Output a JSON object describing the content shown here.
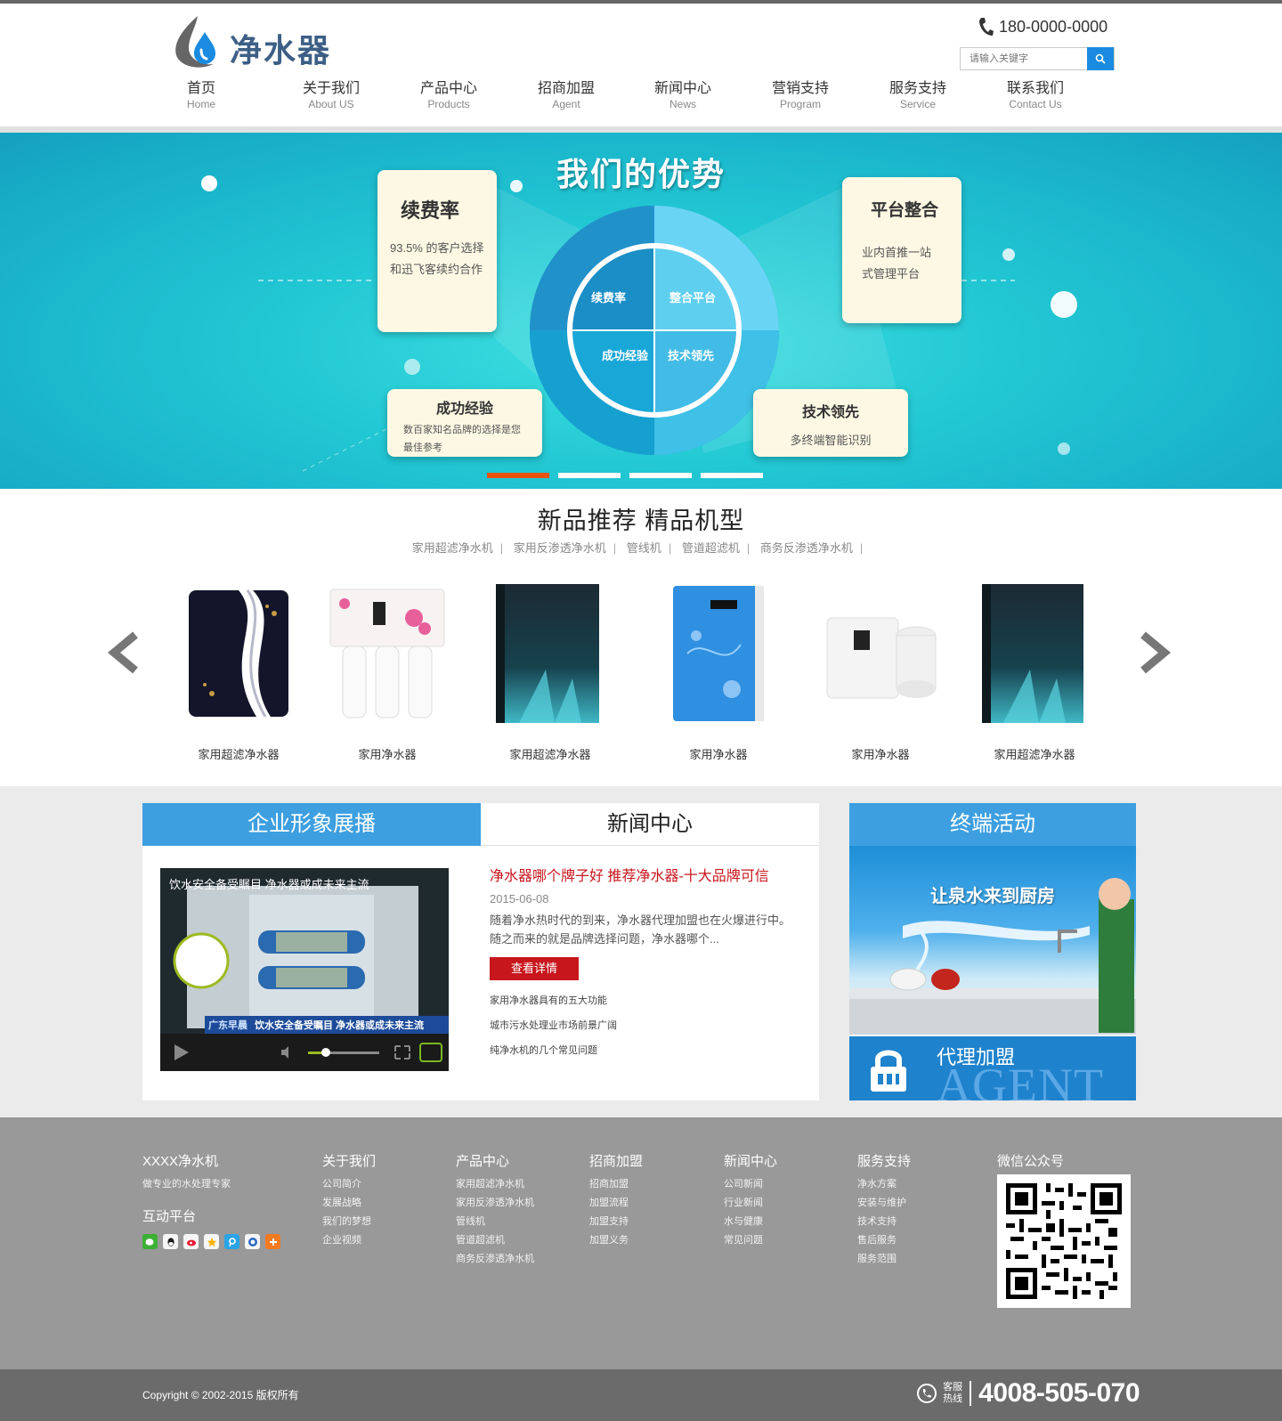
{
  "header": {
    "logo_text": "净水器",
    "phone": "180-0000-0000",
    "search_placeholder": "请输入关键字",
    "nav": [
      {
        "cn": "首页",
        "en": "Home"
      },
      {
        "cn": "关于我们",
        "en": "About US"
      },
      {
        "cn": "产品中心",
        "en": "Products"
      },
      {
        "cn": "招商加盟",
        "en": "Agent"
      },
      {
        "cn": "新闻中心",
        "en": "News"
      },
      {
        "cn": "营销支持",
        "en": "Program"
      },
      {
        "cn": "服务支持",
        "en": "Service"
      },
      {
        "cn": "联系我们",
        "en": "Contact Us"
      }
    ]
  },
  "banner": {
    "title": "我们的优势",
    "cards": [
      {
        "title": "续费率",
        "text": "93.5% 的客户选择和迅飞客续约合作"
      },
      {
        "title": "平台整合",
        "text": "业内首推一站式管理平台"
      },
      {
        "title": "成功经验",
        "text": "数百家知名品牌的选择是您最佳参考"
      },
      {
        "title": "技术领先",
        "text": "多终端智能识别"
      }
    ],
    "quadrants": [
      "续费率",
      "整合平台",
      "成功经验",
      "技术领先"
    ],
    "active_slide": 1,
    "slide_count": 4
  },
  "products": {
    "title": "新品推荐 精品机型",
    "categories": [
      "家用超滤净水机",
      "家用反渗透净水机",
      "管线机",
      "管道超滤机",
      "商务反渗透净水机"
    ],
    "items": [
      {
        "name": "家用超滤净水器"
      },
      {
        "name": "家用净水器"
      },
      {
        "name": "家用超滤净水器"
      },
      {
        "name": "家用净水器"
      },
      {
        "name": "家用净水器"
      },
      {
        "name": "家用超滤净水器"
      }
    ]
  },
  "middle": {
    "tab_left": "企业形象展播",
    "tab_right": "新闻中心",
    "video_caption": "饮水安全备受瞩目 净水器或成未来主流",
    "video_banner": "饮水安全备受瞩目 净水器或成未来主流",
    "video_channel": "广东早晨",
    "news": {
      "title": "净水器哪个牌子好 推荐净水器-十大品牌可信",
      "date": "2015-06-08",
      "summary": "随着净水热时代的到来，净水器代理加盟也在火爆进行中。随之而来的就是品牌选择问题，净水器哪个...",
      "button": "查看详情",
      "links": [
        "家用净水器具有的五大功能",
        "城市污水处理业市场前景广阔",
        "纯净水机的几个常见问题"
      ]
    },
    "right_title": "终端活动",
    "promo_text": "让泉水来到厨房",
    "agent_cn": "代理加盟",
    "agent_en": "AGENT"
  },
  "footer": {
    "brand": "XXXX净水机",
    "slogan": "做专业的水处理专家",
    "interact": "互动平台",
    "columns": [
      {
        "title": "关于我们",
        "links": [
          "公司简介",
          "发展战略",
          "我们的梦想",
          "企业视频"
        ]
      },
      {
        "title": "产品中心",
        "links": [
          "家用超滤净水机",
          "家用反渗透净水机",
          "管线机",
          "管道超滤机",
          "商务反渗透净水机"
        ]
      },
      {
        "title": "招商加盟",
        "links": [
          "招商加盟",
          "加盟流程",
          "加盟支持",
          "加盟义务"
        ]
      },
      {
        "title": "新闻中心",
        "links": [
          "公司新闻",
          "行业新闻",
          "水与健康",
          "常见问题"
        ]
      },
      {
        "title": "服务支持",
        "links": [
          "净水方案",
          "安装与维护",
          "技术支持",
          "售后服务",
          "服务范围"
        ]
      }
    ],
    "wechat_title": "微信公众号",
    "copyright": "Copyright © 2002-2015 版权所有",
    "hotline_label_1": "客服",
    "hotline_label_2": "热线",
    "hotline": "4008-505-070"
  },
  "colors": {
    "accent_blue": "#3d9fe0",
    "news_red": "#c8161d",
    "slide_active": "#e8520c",
    "footer_gray": "#999999"
  }
}
